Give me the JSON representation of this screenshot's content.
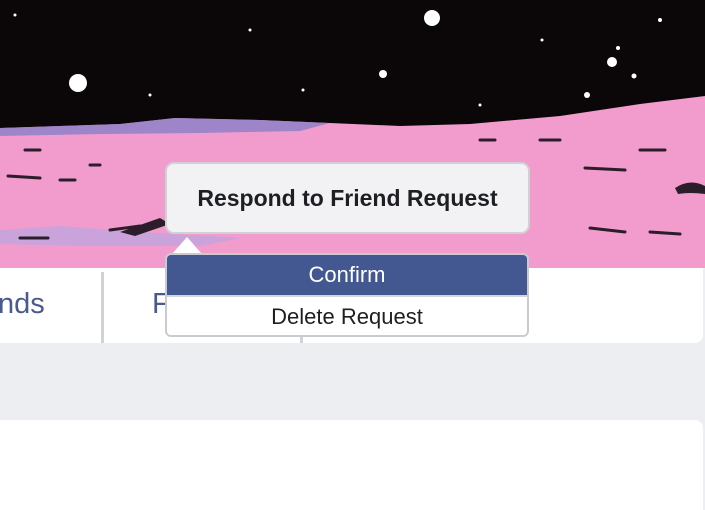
{
  "colors": {
    "sky": "#0b0708",
    "ground": "#f19ccd",
    "accent": "#435891",
    "tab_text": "#4a5a8e",
    "page_background": "#eceef2"
  },
  "cover": {
    "description_icon": "space-landscape-cover-image"
  },
  "tabs": [
    {
      "label": "nds"
    },
    {
      "label": "F"
    }
  ],
  "popup": {
    "title_button": "Respond to Friend Request",
    "menu": {
      "confirm_label": "Confirm",
      "delete_label": "Delete Request"
    }
  }
}
